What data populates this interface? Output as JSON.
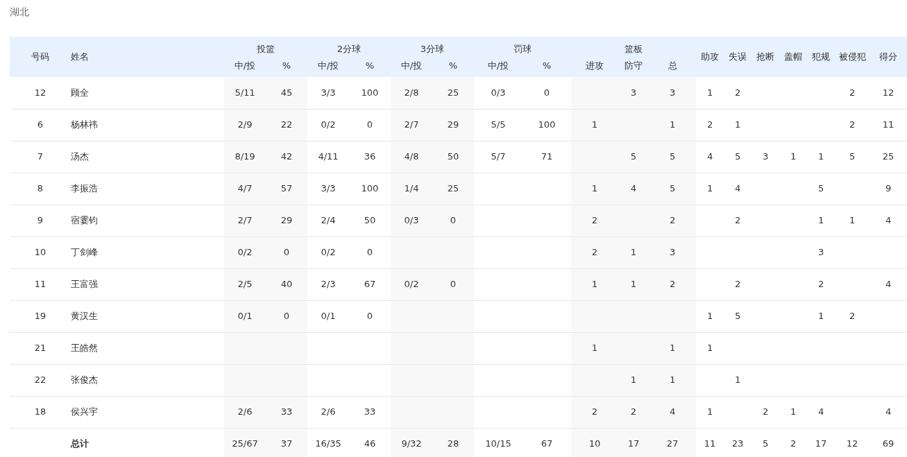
{
  "team": "湖北",
  "columns": [
    {
      "label": "号码"
    },
    {
      "label": "姓名"
    },
    {
      "label": "投篮",
      "sub": [
        "中/投",
        "%"
      ]
    },
    {
      "label": "2分球",
      "sub": [
        "中/投",
        "%"
      ]
    },
    {
      "label": "3分球",
      "sub": [
        "中/投",
        "%"
      ]
    },
    {
      "label": "罚球",
      "sub": [
        "中/投",
        "%"
      ]
    },
    {
      "label": "篮板",
      "sub": [
        "进攻",
        "防守",
        "总"
      ]
    },
    {
      "label": "助攻"
    },
    {
      "label": "失误"
    },
    {
      "label": "抢断"
    },
    {
      "label": "盖帽"
    },
    {
      "label": "犯规"
    },
    {
      "label": "被侵犯"
    },
    {
      "label": "得分"
    }
  ],
  "rows": [
    [
      "12",
      "顾全",
      "5/11",
      "45",
      "3/3",
      "100",
      "2/8",
      "25",
      "0/3",
      "0",
      null,
      "3",
      "3",
      "1",
      "2",
      null,
      null,
      null,
      "2",
      "12"
    ],
    [
      "6",
      "杨林祎",
      "2/9",
      "22",
      "0/2",
      "0",
      "2/7",
      "29",
      "5/5",
      "100",
      "1",
      null,
      "1",
      "2",
      "1",
      null,
      null,
      null,
      "2",
      "11"
    ],
    [
      "7",
      "汤杰",
      "8/19",
      "42",
      "4/11",
      "36",
      "4/8",
      "50",
      "5/7",
      "71",
      null,
      "5",
      "5",
      "4",
      "5",
      "3",
      "1",
      "1",
      "5",
      "25"
    ],
    [
      "8",
      "李振浩",
      "4/7",
      "57",
      "3/3",
      "100",
      "1/4",
      "25",
      null,
      null,
      "1",
      "4",
      "5",
      "1",
      "4",
      null,
      null,
      "5",
      null,
      "9"
    ],
    [
      "9",
      "宿霎钧",
      "2/7",
      "29",
      "2/4",
      "50",
      "0/3",
      "0",
      null,
      null,
      "2",
      null,
      "2",
      null,
      "2",
      null,
      null,
      "1",
      "1",
      "4"
    ],
    [
      "10",
      "丁剑峰",
      "0/2",
      "0",
      "0/2",
      "0",
      null,
      null,
      null,
      null,
      "2",
      "1",
      "3",
      null,
      null,
      null,
      null,
      "3",
      null,
      null
    ],
    [
      "11",
      "王富强",
      "2/5",
      "40",
      "2/3",
      "67",
      "0/2",
      "0",
      null,
      null,
      "1",
      "1",
      "2",
      null,
      "2",
      null,
      null,
      "2",
      null,
      "4"
    ],
    [
      "19",
      "黄汉生",
      "0/1",
      "0",
      "0/1",
      "0",
      null,
      null,
      null,
      null,
      null,
      null,
      null,
      "1",
      "5",
      null,
      null,
      "1",
      "2",
      null
    ],
    [
      "21",
      "王皓然",
      null,
      null,
      null,
      null,
      null,
      null,
      null,
      null,
      "1",
      null,
      "1",
      "1",
      null,
      null,
      null,
      null,
      null,
      null
    ],
    [
      "22",
      "张俊杰",
      null,
      null,
      null,
      null,
      null,
      null,
      null,
      null,
      null,
      "1",
      "1",
      null,
      "1",
      null,
      null,
      null,
      null,
      null
    ],
    [
      "18",
      "侯兴宇",
      "2/6",
      "33",
      "2/6",
      "33",
      null,
      null,
      null,
      null,
      "2",
      "2",
      "4",
      "1",
      null,
      "2",
      "1",
      "4",
      null,
      "4"
    ]
  ],
  "totals": {
    "label": "总计",
    "cells": [
      "25/67",
      "37",
      "16/35",
      "46",
      "9/32",
      "28",
      "10/15",
      "67",
      "10",
      "17",
      "27",
      "11",
      "23",
      "5",
      "2",
      "17",
      "12",
      "69"
    ]
  }
}
